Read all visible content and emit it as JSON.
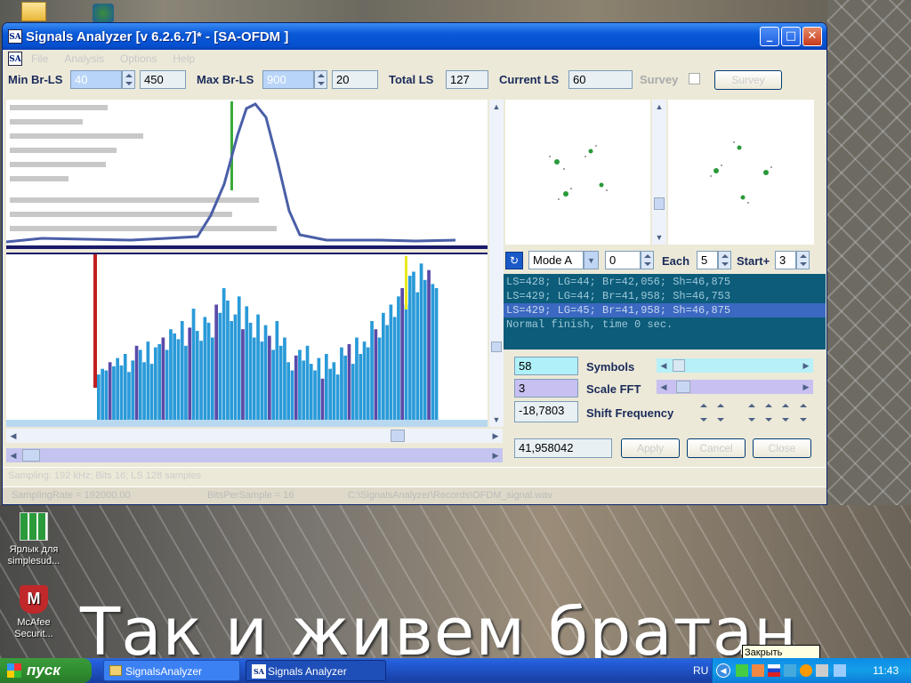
{
  "window": {
    "title": "Signals Analyzer [v 6.2.6.7]* - [SA-OFDM ]",
    "app_icon": "SA"
  },
  "menu": [
    "File",
    "Analysis",
    "Options",
    "Help"
  ],
  "toolbar": {
    "min_br_label": "Min Br-LS",
    "min_br_value": "40",
    "min_br_value2": "450",
    "max_br_label": "Max Br-LS",
    "max_br_value": "900",
    "max_br_value2": "20",
    "total_ls_label": "Total LS",
    "total_ls_value": "127",
    "current_ls_label": "Current LS",
    "current_ls_value": "60",
    "survey_label": "Survey",
    "survey_button": "Survey"
  },
  "mode": {
    "mode_value": "Mode A",
    "index_value": "0",
    "each_label": "Each",
    "each_value": "5",
    "start_label": "Start+",
    "start_value": "3"
  },
  "log": [
    "LS=428; LG=44; Br=42,056; Sh=46,875",
    "LS=429; LG=44; Br=41,958; Sh=46,753",
    "LS=429; LG=45; Br=41,958; Sh=46,875",
    "Normal finish, time 0 sec."
  ],
  "controls": {
    "symbols_value": "58",
    "symbols_label": "Symbols",
    "scale_fft_value": "3",
    "scale_fft_label": "Scale FFT",
    "shift_value": "-18,7803",
    "shift_label": "Shift Frequency",
    "freq_value": "41,958042",
    "btn1": "Apply",
    "btn2": "Cancel",
    "btn3": "Close"
  },
  "status": {
    "line1": "Sampling: 192 kHz; Bits 16; LS 128 samples",
    "sampling": "SamplingRate = 192000.00",
    "bits": "BitsPerSample = 16",
    "file": "C:\\SignalsAnalyzer\\Records\\OFDM_signal.wav"
  },
  "desktop": {
    "icons": [
      {
        "label": "Ярлык для simplesud..."
      },
      {
        "label": "McAfee Securit..."
      }
    ],
    "caption": "Так и живем братан"
  },
  "taskbar": {
    "start": "пуск",
    "tasks": [
      "SignalsAnalyzer",
      "Signals Analyzer"
    ],
    "lang": "RU",
    "clock": "11:43",
    "tooltip": "Закрыть"
  },
  "chart_data": {
    "type": "bar",
    "values": [
      55,
      62,
      60,
      70,
      65,
      75,
      66,
      80,
      58,
      72,
      90,
      85,
      70,
      95,
      68,
      88,
      92,
      100,
      85,
      110,
      105,
      98,
      120,
      90,
      112,
      135,
      108,
      96,
      125,
      118,
      100,
      140,
      130,
      160,
      145,
      120,
      128,
      150,
      110,
      138,
      118,
      100,
      128,
      95,
      115,
      102,
      85,
      120,
      90,
      100,
      70,
      60,
      78,
      85,
      72,
      90,
      68,
      60,
      75,
      50,
      80,
      62,
      70,
      55,
      88,
      78,
      92,
      68,
      100,
      80,
      95,
      88,
      120,
      110,
      100,
      130,
      115,
      140,
      125,
      150,
      160,
      140,
      175,
      180,
      155,
      190,
      170,
      182,
      165,
      160
    ]
  }
}
